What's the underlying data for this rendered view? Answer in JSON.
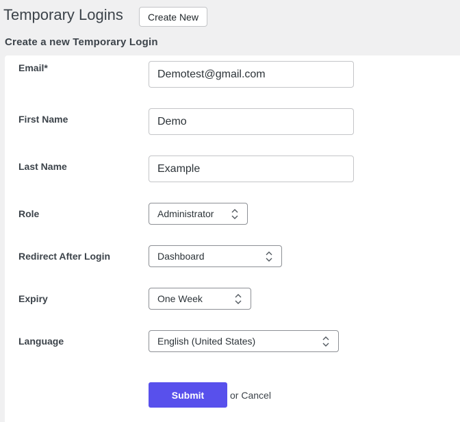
{
  "header": {
    "title": "Temporary Logins",
    "create_new_label": "Create New"
  },
  "form": {
    "heading": "Create a new Temporary Login",
    "email": {
      "label": "Email*",
      "value": "Demotest@gmail.com"
    },
    "first_name": {
      "label": "First Name",
      "value": "Demo"
    },
    "last_name": {
      "label": "Last Name",
      "value": "Example"
    },
    "role": {
      "label": "Role",
      "value": "Administrator",
      "icon": "chevron-up-down-icon"
    },
    "redirect": {
      "label": "Redirect After Login",
      "value": "Dashboard",
      "icon": "chevron-up-down-icon"
    },
    "expiry": {
      "label": "Expiry",
      "value": "One Week",
      "icon": "chevron-up-down-icon"
    },
    "language": {
      "label": "Language",
      "value": "English (United States)",
      "icon": "chevron-up-down-icon"
    },
    "submit_label": "Submit",
    "or_text": "or",
    "cancel_label": "Cancel"
  },
  "colors": {
    "background": "#f0f0f1",
    "panel": "#ffffff",
    "primary_button": "#5850ec",
    "border": "#c3c4c7"
  }
}
